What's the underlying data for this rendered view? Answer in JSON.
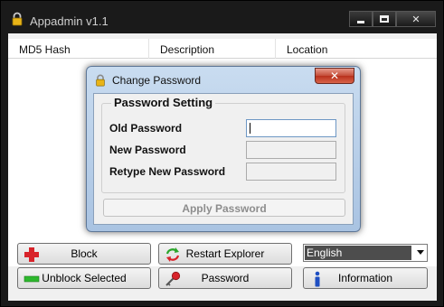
{
  "window": {
    "title": "Appadmin v1.1",
    "minimize_icon": "minimize-icon",
    "maximize_icon": "maximize-icon",
    "close_label": "✕"
  },
  "list": {
    "columns": [
      "MD5 Hash",
      "Description",
      "Location"
    ]
  },
  "buttons": {
    "block": "Block",
    "unblock": "Unblock Selected",
    "restart": "Restart Explorer",
    "password": "Password",
    "information": "Information"
  },
  "language": {
    "selected": "English"
  },
  "dialog": {
    "title": "Change Password",
    "close_label": "✕",
    "group_label": "Password Setting",
    "old_label": "Old Password",
    "new_label": "New Password",
    "retype_label": "Retype New Password",
    "apply_label": "Apply Password"
  },
  "colors": {
    "titlebar": "#1a1a1a",
    "dialog_frame": "#b9d1ea",
    "dialog_close": "#c44b37",
    "selected_lang_bg": "#4d4d4d"
  }
}
